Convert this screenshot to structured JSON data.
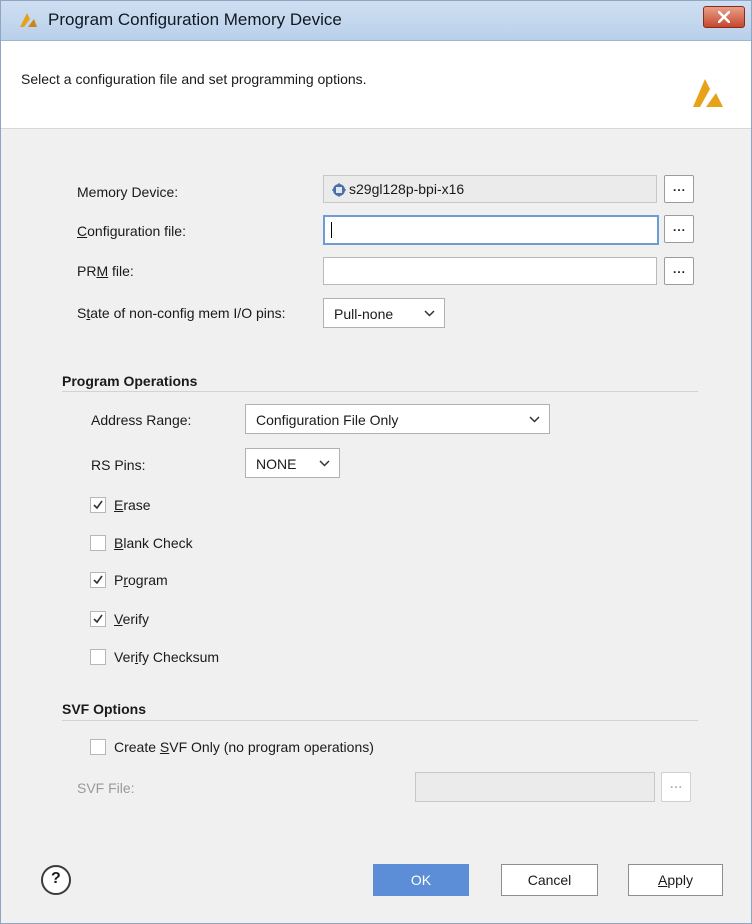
{
  "window": {
    "title": "Program Configuration Memory Device",
    "description": "Select a configuration file and set programming options."
  },
  "device": {
    "memory_device_label": "Memory Device:",
    "memory_device_value": "s29gl128p-bpi-x16",
    "config_file_label": "Configuration file:",
    "config_file_value": "",
    "prm_file_label": "PRM file:",
    "prm_file_value": "",
    "state_pins_label": "State of non-config mem I/O pins:",
    "state_pins_value": "Pull-none",
    "browse_label": "..."
  },
  "program_operations": {
    "title": "Program Operations",
    "address_range_label": "Address Range:",
    "address_range_value": "Configuration File Only",
    "rs_pins_label": "RS Pins:",
    "rs_pins_value": "NONE",
    "options": [
      {
        "label": "Erase",
        "checked": true
      },
      {
        "label": "Blank Check",
        "checked": false
      },
      {
        "label": "Program",
        "checked": true
      },
      {
        "label": "Verify",
        "checked": true
      },
      {
        "label": "Verify Checksum",
        "checked": false
      }
    ]
  },
  "svf_options": {
    "title": "SVF Options",
    "create_svf_label": "Create SVF Only (no program operations)",
    "create_svf_checked": false,
    "svf_file_label": "SVF File:",
    "svf_file_value": ""
  },
  "footer": {
    "help_label": "?",
    "ok_label": "OK",
    "cancel_label": "Cancel",
    "apply_label": "Apply"
  },
  "colors": {
    "accent": "#5c8ed8",
    "logo": "#e8a21a",
    "close_button": "#c7472c"
  }
}
